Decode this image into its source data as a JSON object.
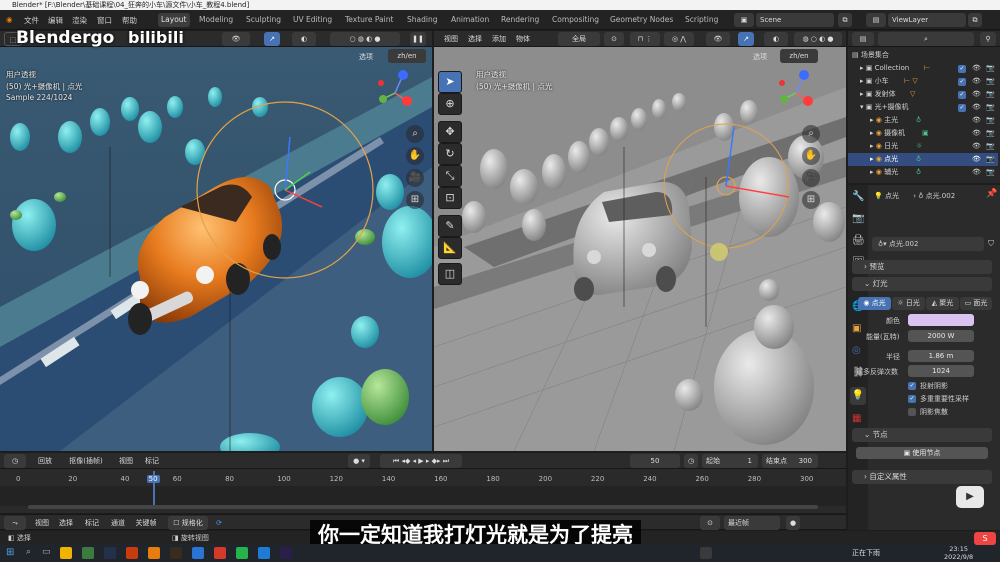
{
  "titlebar": {
    "text": "Blender* [F:\\Blender\\基础课程\\04_狂奔的小车\\源文件\\小车_教程4.blend]"
  },
  "topbar": {
    "menus": [
      "文件",
      "编辑",
      "渲染",
      "窗口",
      "帮助"
    ],
    "workspaces": [
      "Layout",
      "Modeling",
      "Sculpting",
      "UV Editing",
      "Texture Paint",
      "Shading",
      "Animation",
      "Rendering",
      "Compositing",
      "Geometry Nodes",
      "Scripting"
    ],
    "scene": "Scene",
    "view_layer": "ViewLayer"
  },
  "watermark": {
    "brand": "Blendergo",
    "site": "bilibili"
  },
  "left_viewport": {
    "options_label": "选项",
    "lang_button": "zh/en",
    "perspective": "用户透视",
    "object_info": "(50) 光+摄像机 | 点光",
    "samples": "Sample 224/1024"
  },
  "right_viewport": {
    "menus": [
      "视图",
      "选择",
      "添加",
      "物体"
    ],
    "orientation": "全局",
    "options_label": "选项",
    "lang_button": "zh/en",
    "perspective": "用户透视",
    "object_info": "(50) 光+摄像机 | 点光"
  },
  "outliner": {
    "title": "场景集合",
    "rows": [
      {
        "name": "Collection",
        "selected": false
      },
      {
        "name": "小车",
        "selected": false
      },
      {
        "name": "发射体",
        "selected": false
      },
      {
        "name": "光+摄像机",
        "selected": false
      },
      {
        "name": "主光",
        "selected": false
      },
      {
        "name": "摄像机",
        "selected": false
      },
      {
        "name": "日光",
        "selected": false
      },
      {
        "name": "点光",
        "selected": true
      },
      {
        "name": "辅光",
        "selected": false
      }
    ]
  },
  "properties": {
    "breadcrumb_obj": "点光",
    "breadcrumb_data": "点光.002",
    "datablock": "点光.002",
    "panel_preview": "预览",
    "panel_light": "灯光",
    "light_types": [
      "点光",
      "日光",
      "聚光",
      "面光"
    ],
    "color_label": "颜色",
    "color_value": "#d9c3f0",
    "power_label": "能量(瓦特)",
    "power_value": "2000 W",
    "radius_label": "半径",
    "radius_value": "1.86 m",
    "bounces_label": "最多反弹次数",
    "bounces_value": "1024",
    "cast_shadow": "投射阴影",
    "mis": "多重重要性采样",
    "shadow_caustics": "阴影焦散",
    "panel_nodes": "节点",
    "use_nodes": "使用节点",
    "panel_custom": "自定义属性"
  },
  "timeline": {
    "menus": [
      "回放",
      "抠像(插帧)",
      "视图",
      "标记"
    ],
    "current_frame": "50",
    "start_label": "起始",
    "start_value": "1",
    "end_label": "结束点",
    "end_value": "300",
    "ticks": [
      "0",
      "20",
      "40",
      "50",
      "60",
      "80",
      "100",
      "120",
      "140",
      "160",
      "180",
      "200",
      "220",
      "240",
      "260",
      "280",
      "300"
    ],
    "current_frame_fraction": 0.1667
  },
  "graph_header": {
    "menus": [
      "视图",
      "选择",
      "标记",
      "通道",
      "关键帧"
    ],
    "normalize": "规格化",
    "interp": "最近帧"
  },
  "statusbar": {
    "select": "选择",
    "rotate": "旋转视图"
  },
  "subtitle": "你一定知道我打灯光就是为了提亮",
  "taskbar": {
    "status": "正在下雨",
    "time": "23:15",
    "date": "2022/9/8"
  }
}
